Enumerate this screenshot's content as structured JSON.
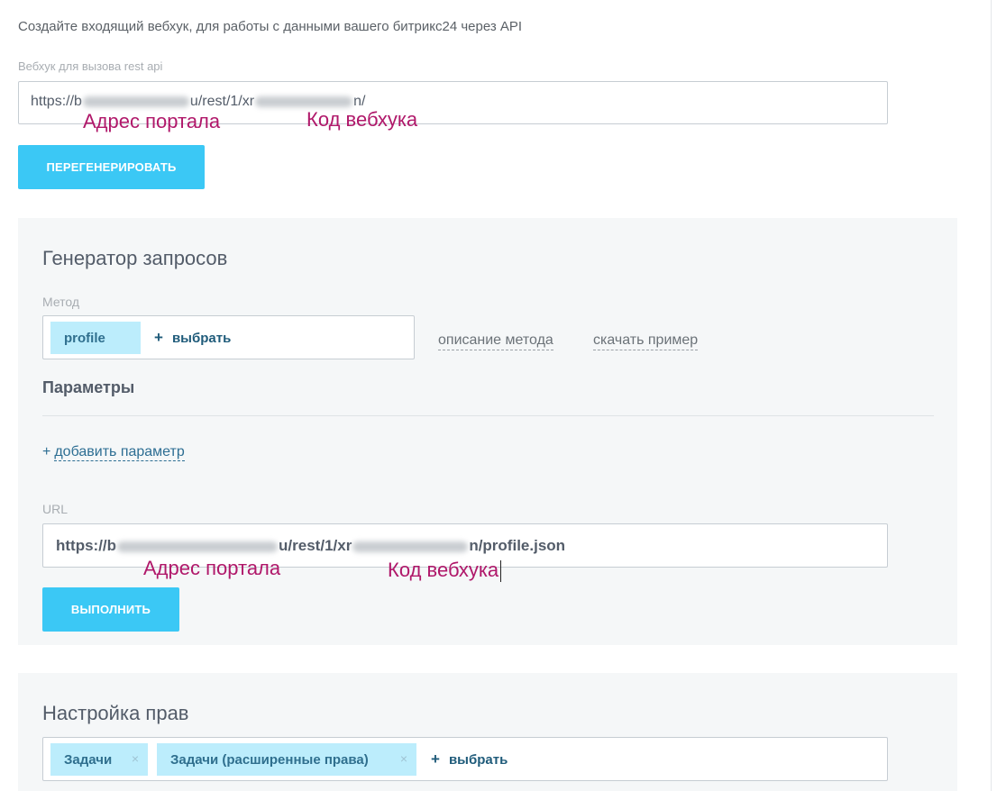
{
  "intro_text": "Создайте входящий вебхук, для работы с данными вашего битрикс24 через API",
  "webhook": {
    "label": "Вебхук для вызова rest api",
    "url_start": "https://b",
    "url_mid": "u/rest/1/xr",
    "url_end": "n/",
    "annotation_portal": "Адрес портала",
    "annotation_code": "Код вебхука",
    "regenerate_label": "ПЕРЕГЕНЕРИРОВАТЬ"
  },
  "generator": {
    "title": "Генератор запросов",
    "method_label": "Метод",
    "method_tag": "profile",
    "choose_label": "выбрать",
    "method_description_link": "описание метода",
    "download_example_link": "скачать пример",
    "params_title": "Параметры",
    "add_param_label": "добавить параметр",
    "url_label": "URL",
    "url_start": "https://b",
    "url_mid": "u/rest/1/xr",
    "url_end": "n/profile.json",
    "annotation_portal": "Адрес портала",
    "annotation_code": "Код вебхука",
    "execute_label": "ВЫПОЛНИТЬ"
  },
  "rights": {
    "title": "Настройка прав",
    "tags": [
      "Задачи",
      "Задачи (расширенные права)"
    ],
    "choose_label": "выбрать",
    "remove_glyph": "×"
  },
  "icons": {
    "plus": "+"
  },
  "colors": {
    "accent": "#3bc8f5",
    "tag_bg": "#bcedfc",
    "annotation": "#b0186a",
    "panel_bg": "#f5f7f8"
  }
}
